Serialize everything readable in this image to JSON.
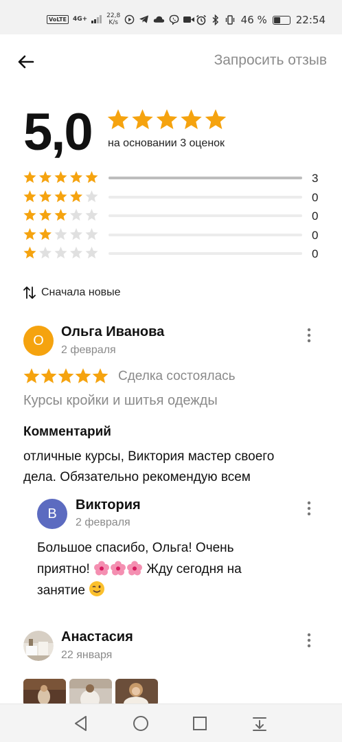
{
  "status_bar": {
    "volte": "VoLTE",
    "network": "4G+",
    "speed_value": "22,8",
    "speed_unit": "K/s",
    "battery_percent": "46 %",
    "battery_level": 0.46,
    "time": "22:54"
  },
  "header": {
    "back_icon": "arrow-left-icon",
    "request_review": "Запросить отзыв"
  },
  "summary": {
    "rating": "5,0",
    "stars": 5,
    "caption": "на основании 3 оценок",
    "star_color": "#f5a30f",
    "histogram": [
      {
        "stars": 5,
        "count": "3",
        "fraction": 1.0
      },
      {
        "stars": 4,
        "count": "0",
        "fraction": 0
      },
      {
        "stars": 3,
        "count": "0",
        "fraction": 0
      },
      {
        "stars": 2,
        "count": "0",
        "fraction": 0
      },
      {
        "stars": 1,
        "count": "0",
        "fraction": 0
      }
    ]
  },
  "sort": {
    "icon": "sort-arrows-icon",
    "label": "Сначала новые"
  },
  "reviews": [
    {
      "avatar_letter": "О",
      "avatar_color": "#f5a30f",
      "author": "Ольга Иванова",
      "date": "2 февраля",
      "stars": 5,
      "deal_status": "Сделка состоялась",
      "course": "Курсы кройки и шитья одежды",
      "comment_heading": "Комментарий",
      "comment_line1": "отличные курсы, Виктория мастер своего",
      "comment_line2": "дела. Обязательно рекомендую всем",
      "reply": {
        "avatar_letter": "В",
        "avatar_color": "#5c6bc0",
        "author": "Виктория",
        "date": "2 февраля",
        "line1": "Большое спасибо, Ольга! Очень",
        "line2_after_emoji": "Жду сегодня на",
        "line2_before_emoji": "приятно!",
        "line3": "занятие"
      }
    },
    {
      "author": "Анастасия",
      "date": "22 января",
      "photos": 3
    }
  ],
  "nav_bar": {
    "back": "triangle-back-icon",
    "home": "circle-home-icon",
    "recents": "square-recents-icon",
    "notifications": "pull-down-icon"
  }
}
